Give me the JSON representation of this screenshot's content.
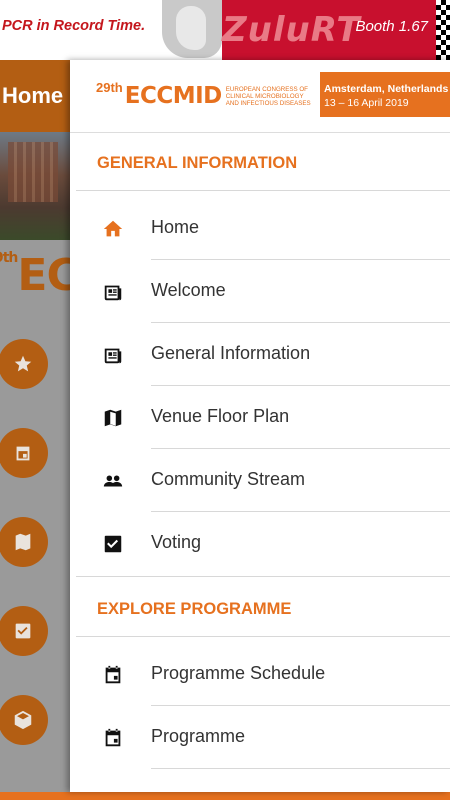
{
  "banner": {
    "tagline": "PCR in Record Time.",
    "brand": "ZuluRT",
    "booth": "Booth 1.67"
  },
  "background": {
    "header_label": "Home",
    "title_num": "9th",
    "title_text": "EC",
    "buttons": [
      "star-icon",
      "calendar-icon",
      "map-icon",
      "checkbox-icon",
      "cube-icon"
    ]
  },
  "drawer": {
    "logo": {
      "number": "29th",
      "name": "ECCMID",
      "subtitle": "European Congress of Clinical Microbiology and Infectious Diseases",
      "city": "Amsterdam, Netherlands",
      "dates": "13 – 16 April 2019"
    },
    "sections": [
      {
        "title": "GENERAL INFORMATION",
        "items": [
          {
            "label": "Home",
            "icon": "home-icon",
            "color": "#e6711f"
          },
          {
            "label": "Welcome",
            "icon": "newspaper-icon"
          },
          {
            "label": "General Information",
            "icon": "newspaper-icon"
          },
          {
            "label": "Venue Floor Plan",
            "icon": "map-icon"
          },
          {
            "label": "Community Stream",
            "icon": "people-icon"
          },
          {
            "label": "Voting",
            "icon": "checkbox-icon"
          }
        ]
      },
      {
        "title": "EXPLORE PROGRAMME",
        "items": [
          {
            "label": "Programme Schedule",
            "icon": "calendar-icon"
          },
          {
            "label": "Programme",
            "icon": "calendar-icon"
          }
        ]
      }
    ]
  },
  "colors": {
    "accent": "#e6711f",
    "accent_dark": "#b35e13",
    "banner_red": "#c8102e"
  }
}
